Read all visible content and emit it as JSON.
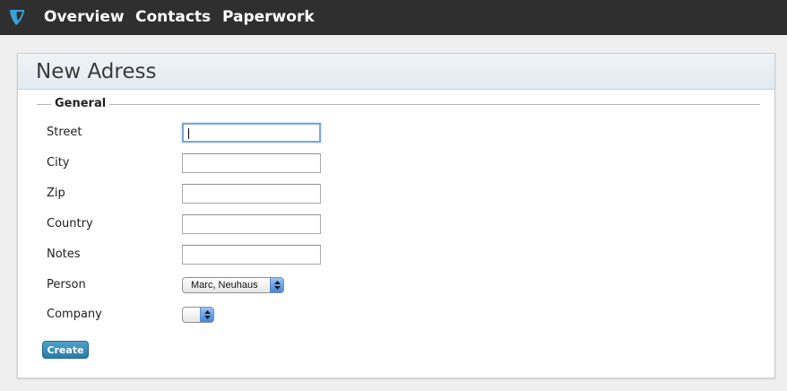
{
  "nav": {
    "logo_icon": "typo3-logo-icon",
    "items": [
      "Overview",
      "Contacts",
      "Paperwork"
    ]
  },
  "panel": {
    "title": "New Adress",
    "legend": "General"
  },
  "form": {
    "fields": [
      {
        "label": "Street",
        "value": ""
      },
      {
        "label": "City",
        "value": ""
      },
      {
        "label": "Zip",
        "value": ""
      },
      {
        "label": "Country",
        "value": ""
      },
      {
        "label": "Notes",
        "value": ""
      }
    ],
    "person": {
      "label": "Person",
      "selected": "Marc, Neuhaus"
    },
    "company": {
      "label": "Company",
      "selected": ""
    },
    "submit_label": "Create"
  },
  "colors": {
    "topbar": "#2f2f2f",
    "logo": "#3aa0d6",
    "button": "#2f87b3",
    "focus_ring": "#7aa7d9"
  }
}
